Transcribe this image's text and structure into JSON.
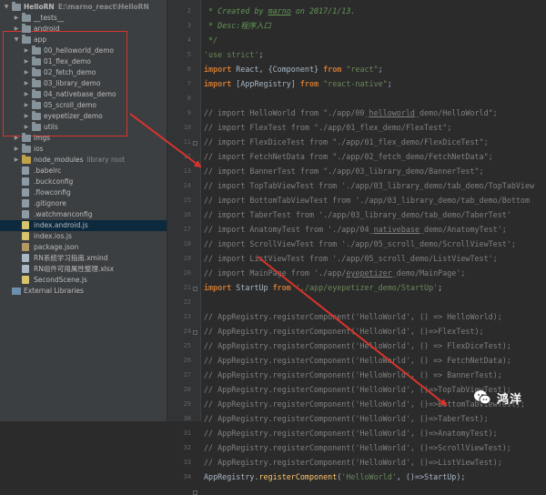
{
  "colors": {
    "accent_red": "#d9342b",
    "sidebar_bg": "#3c3f41",
    "editor_bg": "#2b2b2b",
    "selected_row": "#0d293e"
  },
  "project_tree": [
    {
      "name": "HelloRN",
      "path": "E:\\marno_react\\HelloRN",
      "depth": 0,
      "expanded": true,
      "icon": "folder-icon",
      "kind": "folder",
      "bold": true
    },
    {
      "name": "__tests__",
      "depth": 1,
      "expanded": false,
      "icon": "folder-icon",
      "kind": "folder"
    },
    {
      "name": "android",
      "depth": 1,
      "expanded": false,
      "icon": "folder-icon",
      "kind": "folder"
    },
    {
      "name": "app",
      "depth": 1,
      "expanded": true,
      "icon": "folder-icon",
      "kind": "folder"
    },
    {
      "name": "00_helloworld_demo",
      "depth": 2,
      "expanded": false,
      "icon": "folder-icon",
      "kind": "folder"
    },
    {
      "name": "01_flex_demo",
      "depth": 2,
      "expanded": false,
      "icon": "folder-icon",
      "kind": "folder"
    },
    {
      "name": "02_fetch_demo",
      "depth": 2,
      "expanded": false,
      "icon": "folder-icon",
      "kind": "folder"
    },
    {
      "name": "03_library_demo",
      "depth": 2,
      "expanded": false,
      "icon": "folder-icon",
      "kind": "folder"
    },
    {
      "name": "04_nativebase_demo",
      "depth": 2,
      "expanded": false,
      "icon": "folder-icon",
      "kind": "folder"
    },
    {
      "name": "05_scroll_demo",
      "depth": 2,
      "expanded": false,
      "icon": "folder-icon",
      "kind": "folder"
    },
    {
      "name": "eyepetizer_demo",
      "depth": 2,
      "expanded": false,
      "icon": "folder-icon",
      "kind": "folder"
    },
    {
      "name": "utils",
      "depth": 2,
      "expanded": false,
      "icon": "folder-icon",
      "kind": "folder"
    },
    {
      "name": "imgs",
      "depth": 1,
      "expanded": false,
      "icon": "folder-icon",
      "kind": "folder"
    },
    {
      "name": "ios",
      "depth": 1,
      "expanded": false,
      "icon": "folder-icon",
      "kind": "folder"
    },
    {
      "name": "node_modules",
      "path": "library root",
      "depth": 1,
      "expanded": false,
      "icon": "folder-icon",
      "kind": "pkg"
    },
    {
      "name": ".babelrc",
      "depth": 1,
      "icon": "file-icon",
      "kind": "cfg"
    },
    {
      "name": ".buckconfig",
      "depth": 1,
      "icon": "file-icon",
      "kind": "cfg"
    },
    {
      "name": ".flowconfig",
      "depth": 1,
      "icon": "file-icon",
      "kind": "cfg"
    },
    {
      "name": ".gitignore",
      "depth": 1,
      "icon": "file-icon",
      "kind": "cfg"
    },
    {
      "name": ".watchmanconfig",
      "depth": 1,
      "icon": "file-icon",
      "kind": "cfg"
    },
    {
      "name": "index.android.js",
      "depth": 1,
      "icon": "js-file-icon",
      "kind": "js",
      "selected": true
    },
    {
      "name": "index.ios.js",
      "depth": 1,
      "icon": "js-file-icon",
      "kind": "js"
    },
    {
      "name": "package.json",
      "depth": 1,
      "icon": "json-file-icon",
      "kind": "json"
    },
    {
      "name": "RN系统学习指南.xmind",
      "depth": 1,
      "icon": "file-icon",
      "kind": "file"
    },
    {
      "name": "RN组件可用属性整理.xlsx",
      "depth": 1,
      "icon": "file-icon",
      "kind": "file"
    },
    {
      "name": "SecondScene.js",
      "depth": 1,
      "icon": "js-file-icon",
      "kind": "js"
    },
    {
      "name": "External Libraries",
      "depth": 0,
      "icon": "library-icon",
      "kind": "lib"
    }
  ],
  "gutter_lines": [
    "2",
    "3",
    "4",
    "5",
    "6",
    "7",
    "8",
    "9",
    "10",
    "11",
    "12",
    "13",
    "14",
    "15",
    "16",
    "17",
    "18",
    "19",
    "20",
    "21",
    "22",
    "23",
    "24",
    "25",
    "26",
    "27",
    "28",
    "29",
    "30",
    "31",
    "32",
    "33",
    "34"
  ],
  "code_lines": [
    [
      {
        "t": " * Created by ",
        "c": "cm"
      },
      {
        "t": "marno",
        "c": "cm",
        "u": true
      },
      {
        "t": " on 2017/1/13.",
        "c": "cm"
      }
    ],
    [
      {
        "t": " * Desc:程序入口",
        "c": "cm"
      }
    ],
    [
      {
        "t": " */",
        "c": "cm"
      }
    ],
    [
      {
        "t": "'use strict'",
        "c": "st"
      },
      {
        "t": ";",
        "c": "id"
      }
    ],
    [
      {
        "t": "import ",
        "c": "kw"
      },
      {
        "t": "React, {Component} ",
        "c": "id"
      },
      {
        "t": "from ",
        "c": "kw"
      },
      {
        "t": "\"react\"",
        "c": "st"
      },
      {
        "t": ";",
        "c": "id"
      }
    ],
    [
      {
        "t": "import ",
        "c": "kw"
      },
      {
        "t": "[AppRegistry] ",
        "c": "id"
      },
      {
        "t": "from ",
        "c": "kw"
      },
      {
        "t": "\"react-native\"",
        "c": "st"
      },
      {
        "t": ";",
        "c": "id"
      }
    ],
    [
      {
        "t": "",
        "c": "id"
      }
    ],
    [
      {
        "t": "// import HelloWorld from \"./app/00_",
        "c": "lc"
      },
      {
        "t": "helloworld",
        "c": "lc",
        "u": true
      },
      {
        "t": "_demo/HelloWorld\";",
        "c": "lc"
      }
    ],
    [
      {
        "t": "// import FlexTest from \"./app/01_flex_demo/FlexTest\";",
        "c": "lc"
      }
    ],
    [
      {
        "t": "// import FlexDiceTest from \"./app/01_flex_demo/FlexDiceTest\";",
        "c": "lc"
      }
    ],
    [
      {
        "t": "// import FetchNetData from \"./app/02_fetch_demo/FetchNetData\";",
        "c": "lc"
      }
    ],
    [
      {
        "t": "// import BannerTest from \"./app/03_library_demo/BannerTest\";",
        "c": "lc"
      }
    ],
    [
      {
        "t": "// import TopTabViewTest from './app/03_library_demo/tab_demo/TopTabView",
        "c": "lc"
      }
    ],
    [
      {
        "t": "// import BottomTabViewTest from './app/03_library_demo/tab_demo/Bottom",
        "c": "lc"
      }
    ],
    [
      {
        "t": "// import TaberTest from './app/03_library_demo/tab_demo/TaberTest'",
        "c": "lc"
      }
    ],
    [
      {
        "t": "// import AnatomyTest from './app/04_",
        "c": "lc"
      },
      {
        "t": "nativebase",
        "c": "lc",
        "u": true
      },
      {
        "t": "_demo/AnatomyTest';",
        "c": "lc"
      }
    ],
    [
      {
        "t": "// import ScrollViewTest from './app/05_scroll_demo/ScrollViewTest';",
        "c": "lc"
      }
    ],
    [
      {
        "t": "// import ListViewTest from './app/05_scroll_demo/ListViewTest';",
        "c": "lc"
      }
    ],
    [
      {
        "t": "// import MainPage from './app/",
        "c": "lc"
      },
      {
        "t": "eyepetizer",
        "c": "lc",
        "u": true
      },
      {
        "t": "_demo/MainPage';",
        "c": "lc"
      }
    ],
    [
      {
        "t": "import ",
        "c": "kw"
      },
      {
        "t": "StartUp ",
        "c": "id"
      },
      {
        "t": "from ",
        "c": "kw"
      },
      {
        "t": "'./app/eyepetizer_demo/StartUp'",
        "c": "st"
      },
      {
        "t": ";",
        "c": "id"
      }
    ],
    [
      {
        "t": "",
        "c": "id"
      }
    ],
    [
      {
        "t": "// AppRegistry.registerComponent('HelloWorld', () => HelloWorld);",
        "c": "lc"
      }
    ],
    [
      {
        "t": "// AppRegistry.registerComponent('HelloWorld', ()=>FlexTest);",
        "c": "lc"
      }
    ],
    [
      {
        "t": "// AppRegistry.registerComponent('HelloWorld', () => FlexDiceTest);",
        "c": "lc"
      }
    ],
    [
      {
        "t": "// AppRegistry.registerComponent('HelloWorld', () => FetchNetData);",
        "c": "lc"
      }
    ],
    [
      {
        "t": "// AppRegistry.registerComponent('HelloWorld', () => BannerTest);",
        "c": "lc"
      }
    ],
    [
      {
        "t": "// AppRegistry.registerComponent('HelloWorld', ()=>TopTabViewTest);",
        "c": "lc"
      }
    ],
    [
      {
        "t": "// AppRegistry.registerComponent('HelloWorld', ()=>BottomTabViewTest);",
        "c": "lc"
      }
    ],
    [
      {
        "t": "// AppRegistry.registerComponent('HelloWorld', ()=>TaberTest);",
        "c": "lc"
      }
    ],
    [
      {
        "t": "// AppRegistry.registerComponent('HelloWorld', ()=>AnatomyTest);",
        "c": "lc"
      }
    ],
    [
      {
        "t": "// AppRegistry.registerComponent('HelloWorld', ()=>ScrollViewTest);",
        "c": "lc"
      }
    ],
    [
      {
        "t": "// AppRegistry.registerComponent('HelloWorld', ()=>ListViewTest);",
        "c": "lc"
      }
    ],
    [
      {
        "t": "AppRegistry.",
        "c": "id"
      },
      {
        "t": "registerComponent",
        "c": "fn"
      },
      {
        "t": "(",
        "c": "id"
      },
      {
        "t": "'HelloWorld'",
        "c": "st"
      },
      {
        "t": ", ()=>StartUp);",
        "c": "id"
      }
    ]
  ],
  "watermark": {
    "text": "鸿洋",
    "icon": "wechat-icon"
  }
}
